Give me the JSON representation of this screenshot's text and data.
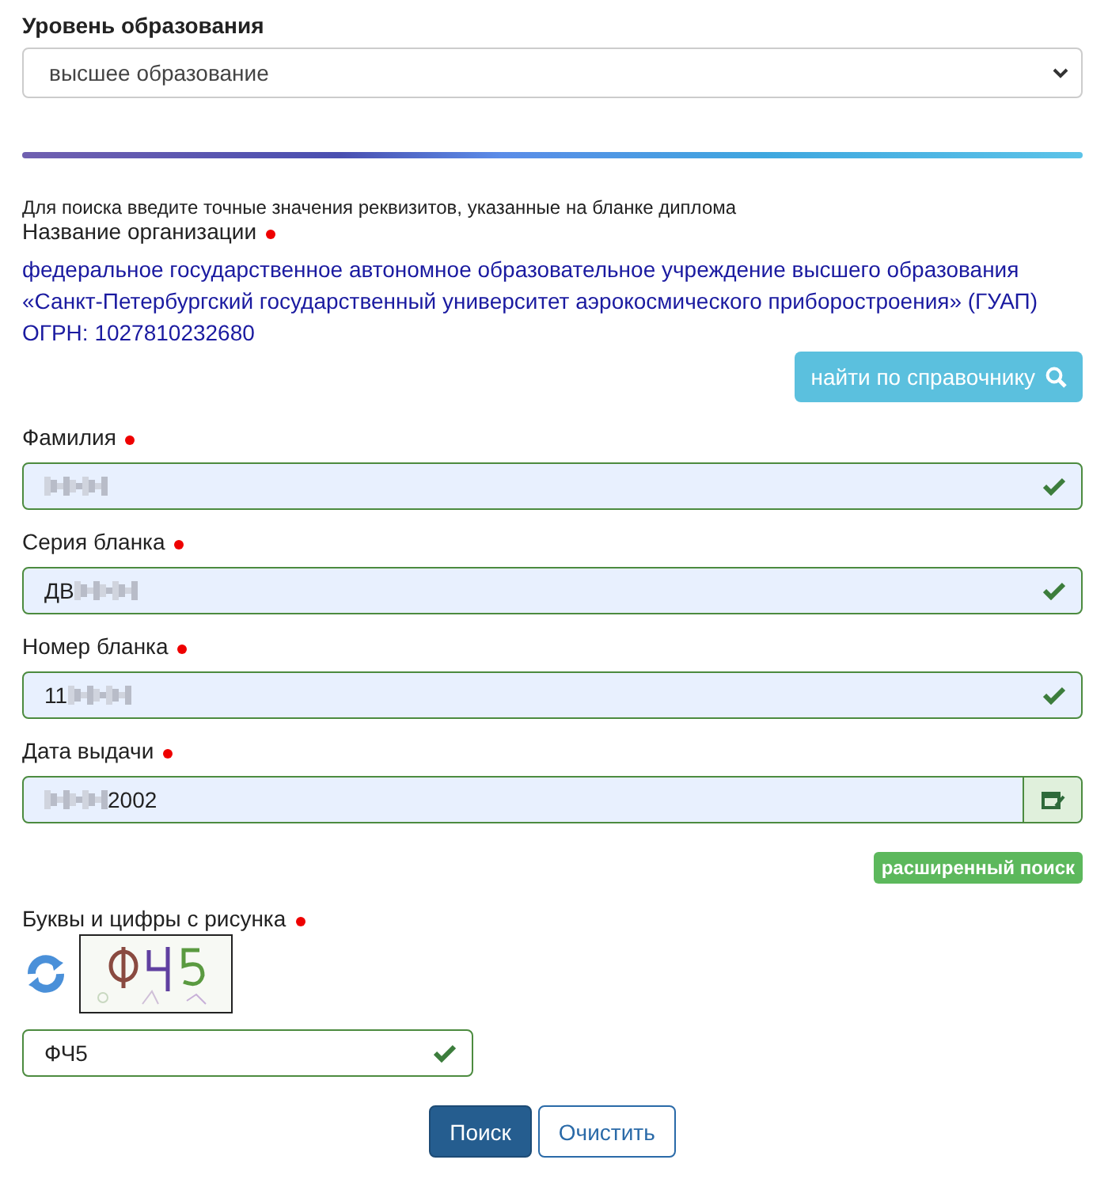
{
  "education_level": {
    "label": "Уровень образования",
    "value": "высшее образование"
  },
  "hint": "Для поиска введите точные значения реквизитов, указанные на бланке диплома",
  "organization": {
    "label": "Название организации",
    "required": true,
    "value": "федеральное государственное автономное образовательное учреждение высшего образования «Санкт-Петербургский государственный университет аэрокосмического приборостроения» (ГУАП) ОГРН: 1027810232680",
    "lookup_button": "найти по справочнику"
  },
  "fields": [
    {
      "kind": "text",
      "label": "Фамилия",
      "required": true,
      "masked_start": false,
      "masked_end": true,
      "valid": true
    },
    {
      "kind": "text",
      "label": "Серия бланка",
      "required": true,
      "value": "ДВ",
      "masked_start": false,
      "masked_end": true,
      "valid": true
    },
    {
      "kind": "text",
      "label": "Номер бланка",
      "required": true,
      "value": "11",
      "masked_start": false,
      "masked_end": true,
      "valid": true
    },
    {
      "kind": "date",
      "label": "Дата выдачи",
      "required": true,
      "value": "2002",
      "masked_start": true,
      "masked_end": false,
      "valid": true
    }
  ],
  "advanced_search": "расширенный поиск",
  "captcha": {
    "label": "Буквы и цифры с рисунка",
    "required": true,
    "value": "ФЧ5",
    "valid": true
  },
  "buttons": [
    {
      "kind": "primary",
      "label": "Поиск"
    },
    {
      "kind": "outline",
      "label": "Очистить"
    }
  ]
}
